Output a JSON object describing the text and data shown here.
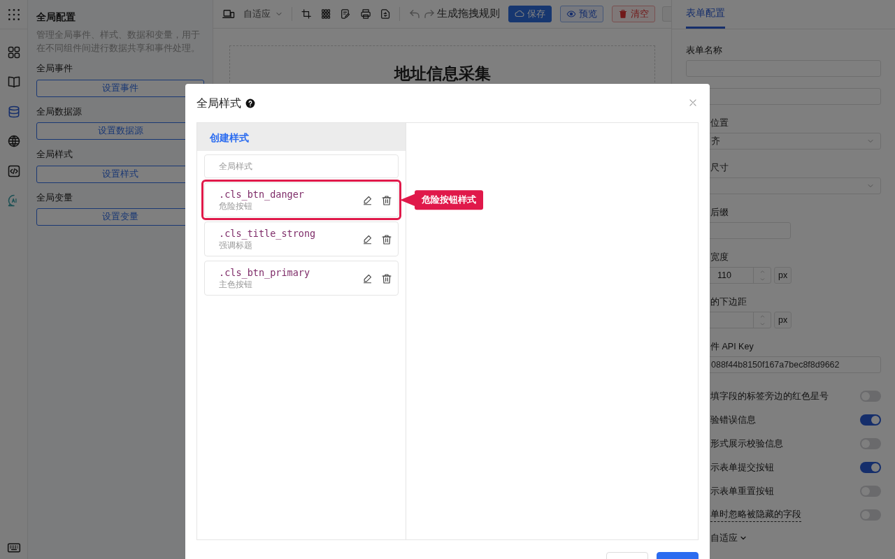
{
  "rail": {
    "items": [
      {
        "kind": "components",
        "selected": false
      },
      {
        "kind": "book",
        "selected": false
      },
      {
        "kind": "database",
        "selected": true
      },
      {
        "kind": "globe",
        "selected": false
      },
      {
        "kind": "code",
        "selected": false
      },
      {
        "kind": "ai",
        "selected": false
      }
    ]
  },
  "left_panel": {
    "title": "全局配置",
    "description": "管理全局事件、样式、数据和变量，用于在不同组件间进行数据共享和事件处理。",
    "sections": [
      {
        "label": "全局事件",
        "button": "设置事件"
      },
      {
        "label": "全局数据源",
        "button": "设置数据源"
      },
      {
        "label": "全局样式",
        "button": "设置样式"
      },
      {
        "label": "全局变量",
        "button": "设置变量"
      }
    ]
  },
  "toolbar": {
    "device_select": "自适应",
    "rule_text": "生成拖拽规则",
    "buttons": [
      {
        "label": "保存",
        "kind": "primary"
      },
      {
        "label": "预览",
        "kind": "preview"
      },
      {
        "label": "清空",
        "kind": "danger"
      }
    ]
  },
  "canvas": {
    "title": "地址信息采集"
  },
  "right_panel": {
    "tabs": [
      {
        "label": "表单配置",
        "selected": true
      }
    ],
    "fields": [
      {
        "kind": "input",
        "label": "表单名称"
      },
      {
        "kind": "input"
      },
      {
        "kind": "select",
        "label": "位置",
        "value": "齐"
      },
      {
        "kind": "select",
        "label": "尺寸"
      },
      {
        "kind": "short",
        "label": "后缀"
      },
      {
        "kind": "number",
        "label": "宽度",
        "value": "110",
        "unit": "px"
      },
      {
        "kind": "number",
        "label": "的下边距",
        "unit": "px"
      },
      {
        "kind": "input",
        "label": "件 API Key",
        "value": "088f44b8150f167a7bec8f8d9662"
      },
      {
        "kind": "toggle",
        "label": "填字段的标签旁边的红色星号",
        "on": false
      },
      {
        "kind": "toggle",
        "label": "验错误信息",
        "on": true
      },
      {
        "kind": "toggle",
        "label": "形式展示校验信息",
        "on": false
      },
      {
        "kind": "toggle",
        "label": "示表单提交按钮",
        "on": true
      },
      {
        "kind": "toggle",
        "label": "示表单重置按钮",
        "on": false
      },
      {
        "kind": "toggle",
        "label": "单时忽略被隐藏的字段",
        "on": false,
        "hint": true
      },
      {
        "kind": "link",
        "label": "自适应"
      }
    ]
  },
  "modal": {
    "title": "全局样式",
    "create_label": "创建样式",
    "styles": [
      {
        "kind": "global",
        "name": "全局样式"
      },
      {
        "kind": "class",
        "name": ".cls_btn_danger",
        "description": "危险按钮",
        "highlighted": true,
        "callout": "危险按钮样式"
      },
      {
        "kind": "class",
        "name": ".cls_title_strong",
        "description": "强调标题",
        "highlighted": false
      },
      {
        "kind": "class",
        "name": ".cls_btn_primary",
        "description": "主色按钮",
        "highlighted": false
      }
    ],
    "buttons": [
      {
        "kind": "cancel"
      },
      {
        "kind": "confirm"
      }
    ]
  }
}
